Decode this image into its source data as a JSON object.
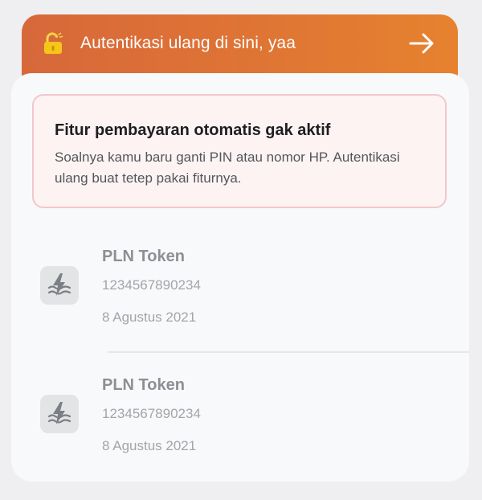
{
  "banner": {
    "title": "Autentikasi ulang di sini, yaa",
    "icons": {
      "lock": "unlocked-padlock-icon",
      "arrow": "arrow-right-icon"
    },
    "colors": {
      "gradient_start": "#d7683a",
      "gradient_end": "#e6822f",
      "lock": "#f5c518"
    }
  },
  "alert": {
    "title": "Fitur pembayaran otomatis gak aktif",
    "body": "Soalnya kamu baru ganti PIN atau nomor HP. Autentikasi ulang buat tetep pakai fiturnya.",
    "colors": {
      "border": "#f2c7cb",
      "background": "#fdf3f3"
    }
  },
  "bills": [
    {
      "icon": "pln-electricity-icon",
      "name": "PLN Token",
      "number": "1234567890234",
      "date": "8 Agustus 2021"
    },
    {
      "icon": "pln-electricity-icon",
      "name": "PLN Token",
      "number": "1234567890234",
      "date": "8 Agustus 2021"
    }
  ]
}
